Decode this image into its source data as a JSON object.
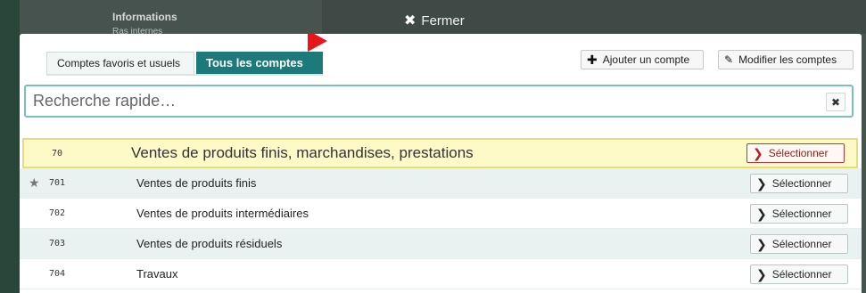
{
  "background": {
    "info_title": "Informations",
    "info_sub": "Ras internes"
  },
  "close_bar": {
    "label": "Fermer",
    "icon": "close-icon"
  },
  "tabs": [
    {
      "label": "Comptes favoris et usuels",
      "active": false
    },
    {
      "label": "Tous les comptes",
      "active": true
    }
  ],
  "toolbar": {
    "add_label": "Ajouter un compte",
    "edit_label": "Modifier les comptes"
  },
  "search": {
    "placeholder": "Recherche rapide…",
    "value": "",
    "clear_icon": "close-icon"
  },
  "accounts": [
    {
      "code": "70",
      "label": "Ventes de produits finis, marchandises, prestations",
      "favorite": false,
      "select_label": "Sélectionner"
    },
    {
      "code": "701",
      "label": "Ventes de produits finis",
      "favorite": true,
      "select_label": "Sélectionner"
    },
    {
      "code": "702",
      "label": "Ventes de produits intermédiaires",
      "favorite": false,
      "select_label": "Sélectionner"
    },
    {
      "code": "703",
      "label": "Ventes de produits résiduels",
      "favorite": false,
      "select_label": "Sélectionner"
    },
    {
      "code": "704",
      "label": "Travaux",
      "favorite": false,
      "select_label": "Sélectionner"
    }
  ],
  "colors": {
    "accent": "#1d7a7a",
    "highlight_row": "#fdfac8",
    "alt_row": "#e9f2f1",
    "flag": "#e8161a"
  }
}
